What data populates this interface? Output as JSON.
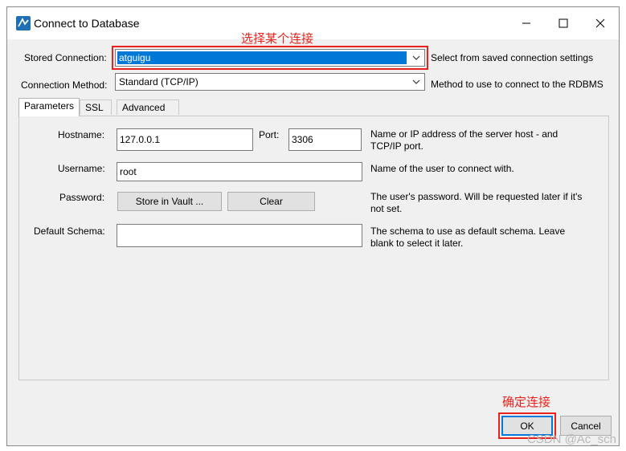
{
  "window": {
    "title": "Connect to Database",
    "controls": {
      "minimize": "minimize-icon",
      "maximize": "maximize-icon",
      "close": "close-icon"
    }
  },
  "annotations": {
    "select_connection": "选择某个连接",
    "confirm_connection": "确定连接"
  },
  "top": {
    "stored_connection_label": "Stored Connection:",
    "stored_connection_value": "atguigu",
    "stored_connection_desc": "Select from saved connection settings",
    "connection_method_label": "Connection Method:",
    "connection_method_value": "Standard (TCP/IP)",
    "connection_method_desc": "Method to use to connect to the RDBMS"
  },
  "tabs": [
    {
      "label": "Parameters",
      "active": true
    },
    {
      "label": "SSL",
      "active": false
    },
    {
      "label": "Advanced",
      "active": false
    }
  ],
  "params": {
    "hostname_label": "Hostname:",
    "hostname_value": "127.0.0.1",
    "port_label": "Port:",
    "port_value": "3306",
    "hostname_desc": "Name or IP address of the server host - and TCP/IP port.",
    "username_label": "Username:",
    "username_value": "root",
    "username_desc": "Name of the user to connect with.",
    "password_label": "Password:",
    "store_vault_button": "Store in Vault ...",
    "clear_button": "Clear",
    "password_desc": "The user's password. Will be requested later if it's not set.",
    "schema_label": "Default Schema:",
    "schema_value": "",
    "schema_desc": "The schema to use as default schema. Leave blank to select it later."
  },
  "footer": {
    "ok_button": "OK",
    "cancel_button": "Cancel"
  },
  "watermark": "CSDN @Ac_sch",
  "colors": {
    "accent": "#0078d7",
    "annotation": "#e8231d",
    "dialog_bg": "#f0f0f0"
  }
}
